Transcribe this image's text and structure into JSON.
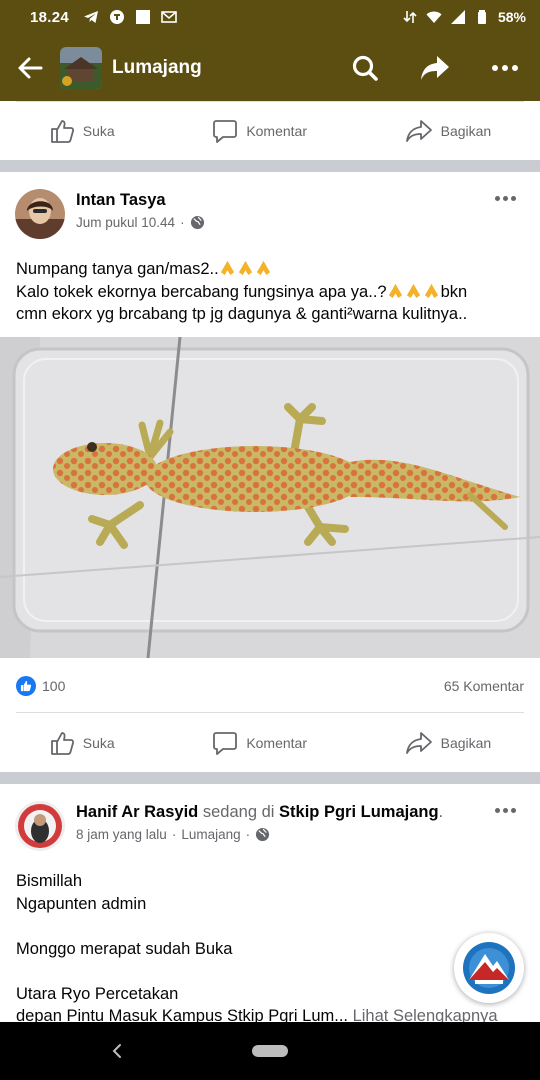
{
  "status_bar": {
    "time": "18.24",
    "battery": "58%"
  },
  "app_bar": {
    "title": "Lumajang"
  },
  "actions": {
    "like": "Suka",
    "comment": "Komentar",
    "share": "Bagikan"
  },
  "post1": {
    "author": "Intan Tasya",
    "time": "Jum pukul 10.44",
    "separator": "·",
    "text_line1": "Numpang tanya gan/mas2..",
    "text_line2a": "Kalo tokek ekornya bercabang fungsinya apa ya..?",
    "text_line2b": "bkn",
    "text_line3": "cmn ekorx yg brcabang tp jg dagunya & ganti²warna kulitnya..",
    "likes": "100",
    "comments": "65 Komentar"
  },
  "post2": {
    "author": "Hanif Ar Rasyid",
    "connector": "sedang di",
    "place": "Stkip Pgri Lumajang",
    "period": ".",
    "time": "8 jam yang lalu",
    "location": "Lumajang",
    "separator": "·",
    "lines": [
      "Bismillah",
      "Ngapunten admin",
      "",
      "Monggo merapat sudah Buka",
      "",
      "Utara Ryo Percetakan"
    ],
    "last_line": "depan Pintu Masuk Kampus Stkip Pgri Lum...",
    "see_more": "Lihat Selengkapnya"
  },
  "colors": {
    "header_bg": "#5b4e10",
    "facebook_blue": "#1877f2",
    "muted_text": "#65676b",
    "divider": "#c9ccd1"
  }
}
